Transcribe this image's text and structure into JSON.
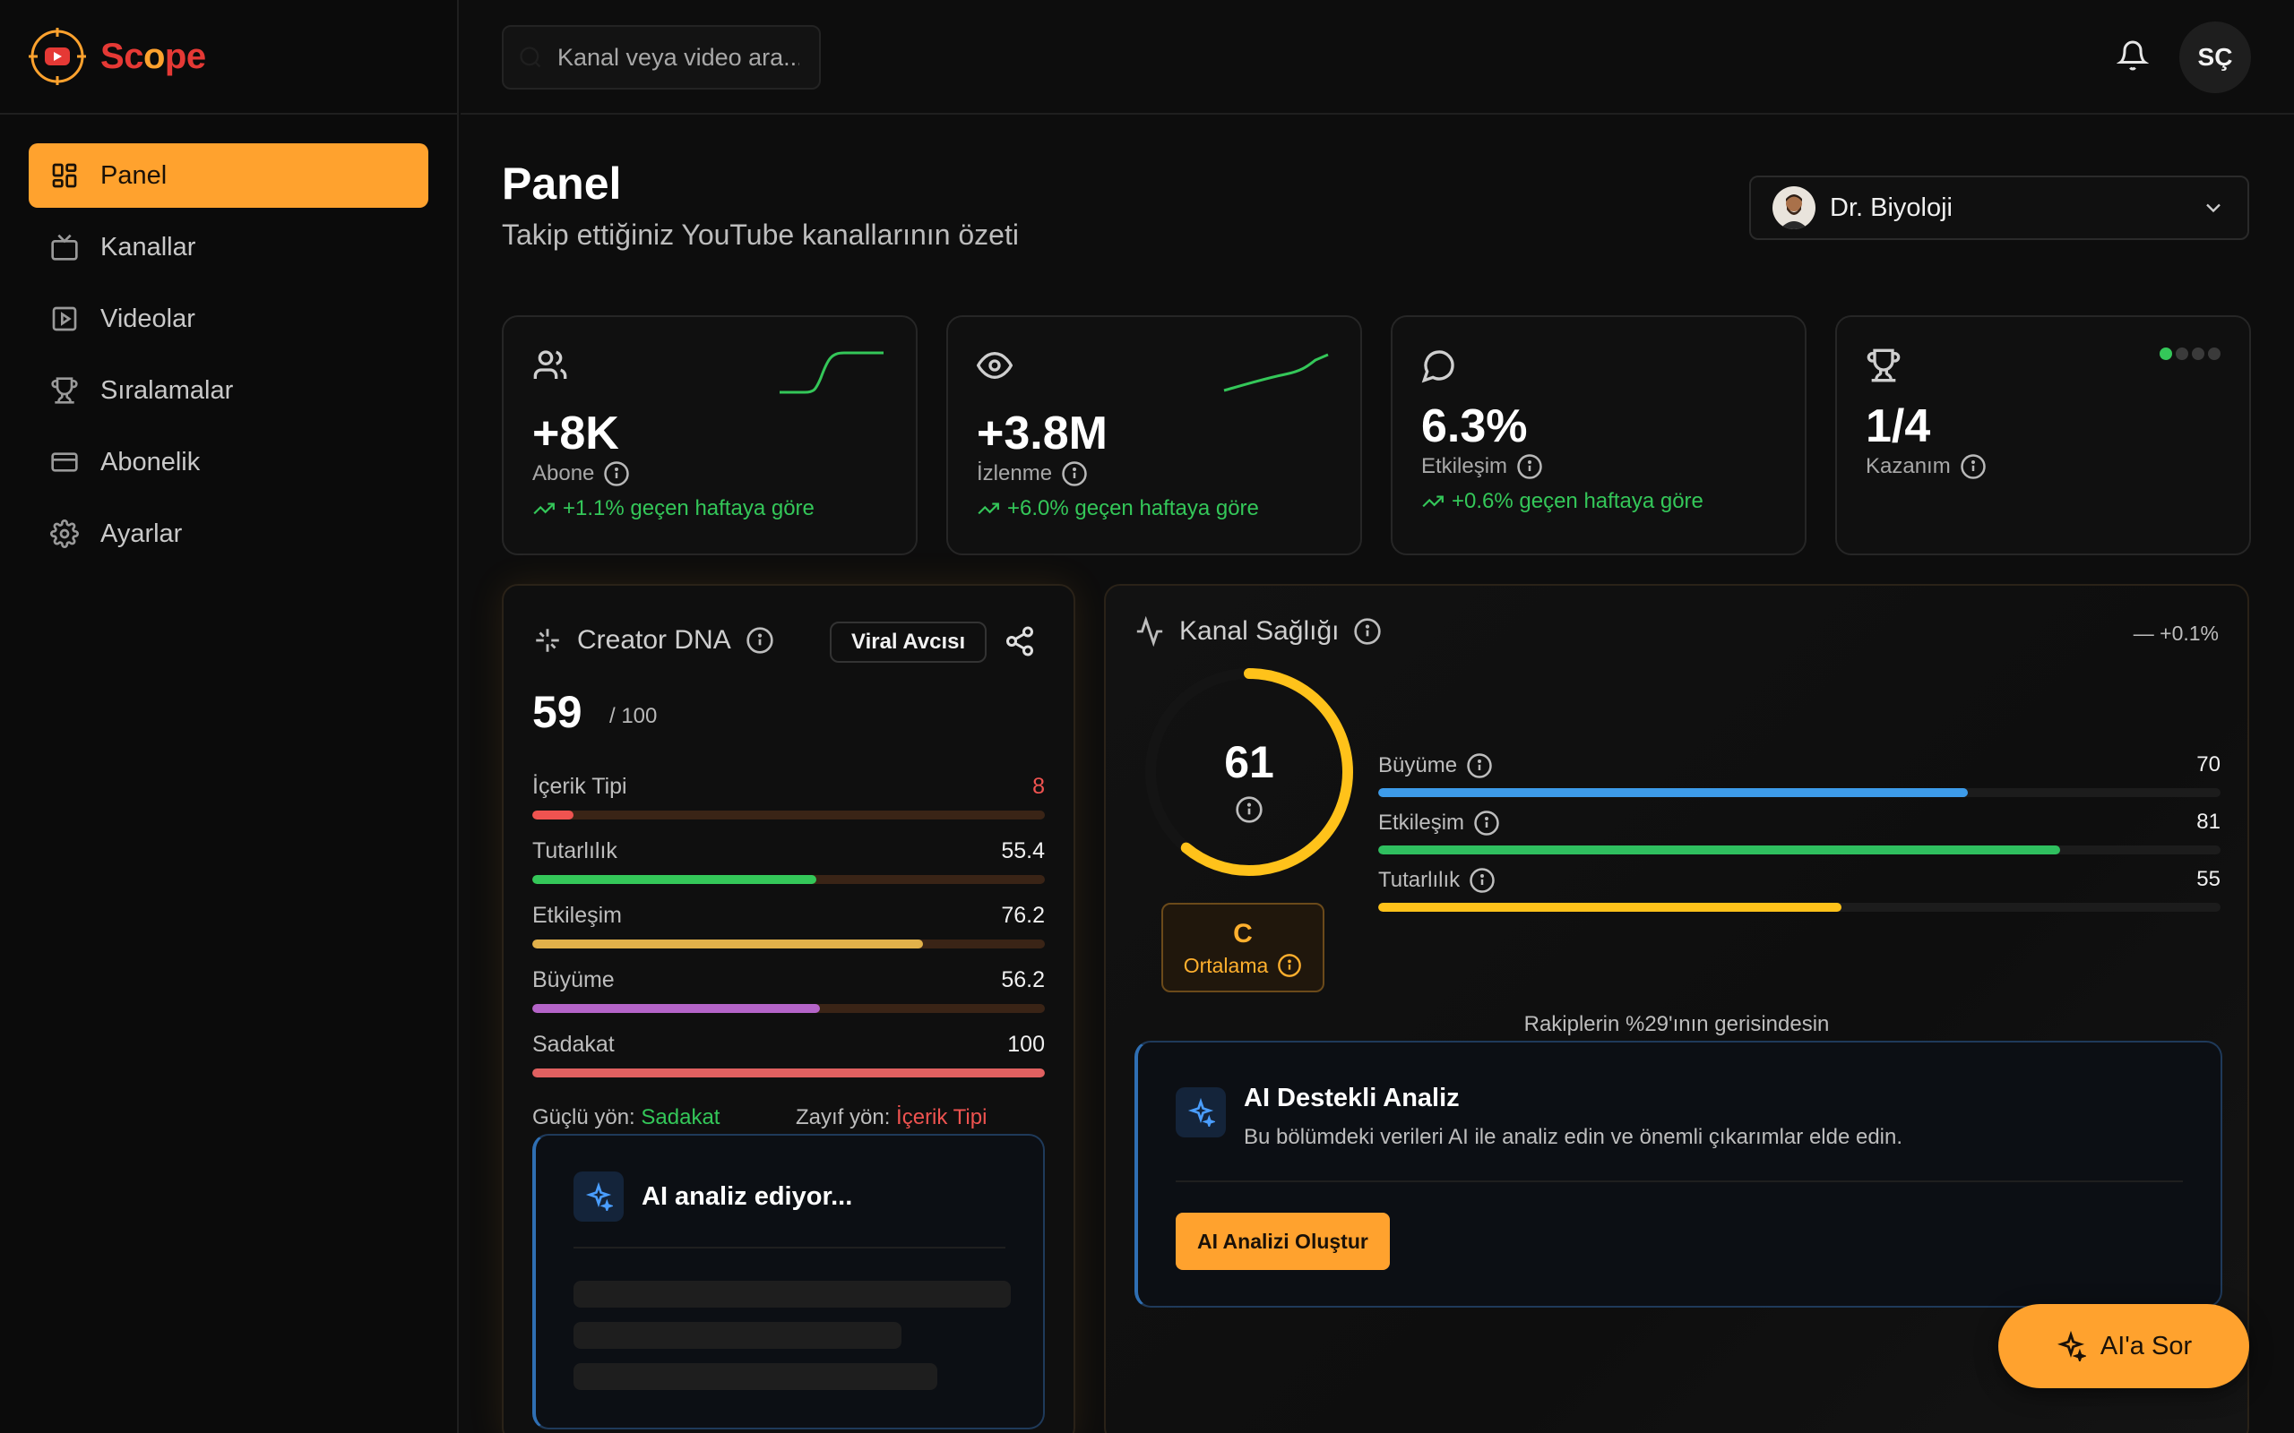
{
  "app": {
    "logo_parts": [
      "S",
      "c",
      "o",
      "p",
      "e"
    ]
  },
  "sidebar": {
    "items": [
      {
        "label": "Panel",
        "icon": "dashboard-icon",
        "active": true
      },
      {
        "label": "Kanallar",
        "icon": "tv-icon"
      },
      {
        "label": "Videolar",
        "icon": "video-icon"
      },
      {
        "label": "Sıralamalar",
        "icon": "trophy-icon"
      },
      {
        "label": "Abonelik",
        "icon": "credit-card-icon"
      },
      {
        "label": "Ayarlar",
        "icon": "gear-icon"
      }
    ]
  },
  "topbar": {
    "search_placeholder": "Kanal veya video ara...",
    "user_initials": "SÇ"
  },
  "page": {
    "title": "Panel",
    "subtitle": "Takip ettiğiniz YouTube kanallarının özeti",
    "selected_channel": "Dr. Biyoloji"
  },
  "stats": [
    {
      "value": "+8K",
      "label": "Abone",
      "change": "+1.1% geçen haftaya göre",
      "icon": "users-icon"
    },
    {
      "value": "+3.8M",
      "label": "İzlenme",
      "change": "+6.0% geçen haftaya göre",
      "icon": "eye-icon"
    },
    {
      "value": "6.3%",
      "label": "Etkileşim",
      "change": "+0.6% geçen haftaya göre",
      "icon": "chat-bubble-icon"
    },
    {
      "value": "1/4",
      "label": "Kazanım",
      "icon": "trophy-icon",
      "progress_dots": 1,
      "total_dots": 4
    }
  ],
  "dna": {
    "title": "Creator DNA",
    "badge": "Viral Avcısı",
    "score": "59",
    "max": "/ 100",
    "metrics": [
      {
        "label": "İçerik Tipi",
        "value": "8",
        "pct": 8,
        "color": "#ef5350",
        "value_color": "#ef5350"
      },
      {
        "label": "Tutarlılık",
        "value": "55.4",
        "pct": 55.4,
        "color": "#34c759"
      },
      {
        "label": "Etkileşim",
        "value": "76.2",
        "pct": 76.2,
        "color": "#e2b14a"
      },
      {
        "label": "Büyüme",
        "value": "56.2",
        "pct": 56.2,
        "color": "#b464c8"
      },
      {
        "label": "Sadakat",
        "value": "100",
        "pct": 100,
        "color": "#e06060"
      }
    ],
    "strong_label": "Güçlü yön:",
    "strong_value": "Sadakat",
    "weak_label": "Zayıf yön:",
    "weak_value": "İçerik Tipi",
    "ai_title": "AI analiz ediyor..."
  },
  "health": {
    "title": "Kanal Sağlığı",
    "delta": "+0.1%",
    "score": "61",
    "score_fraction": 0.61,
    "grade": "C",
    "grade_label": "Ortalama",
    "metrics": [
      {
        "label": "Büyüme",
        "value": "70",
        "pct": 70,
        "color": "#3d9be9"
      },
      {
        "label": "Etkileşim",
        "value": "81",
        "pct": 81,
        "color": "#2fbf5f"
      },
      {
        "label": "Tutarlılık",
        "value": "55",
        "pct": 55,
        "color": "#ffc21a"
      }
    ],
    "behind_text": "Rakiplerin %29'ının gerisindesin",
    "ai_title": "AI Destekli Analiz",
    "ai_desc": "Bu bölümdeki verileri AI ile analiz edin ve önemli çıkarımlar elde edin.",
    "ai_button": "AI Analizi Oluştur"
  },
  "fab_label": "AI'a Sor",
  "colors": {
    "accent": "#ffa22e",
    "positive": "#34c759",
    "negative": "#ef5350",
    "background": "#0d0d0d"
  }
}
